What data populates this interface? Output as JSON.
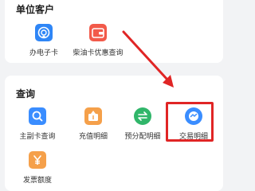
{
  "sections": {
    "top": {
      "title": "单位客户",
      "items": [
        {
          "label": "办电子卡",
          "icon": "e-card-icon",
          "color": "#2f86f6"
        },
        {
          "label": "柴油卡优惠查询",
          "icon": "wallet-icon",
          "color": "#f25a4a"
        }
      ]
    },
    "query": {
      "title": "查询",
      "items": [
        {
          "label": "主副卡查询",
          "icon": "search-icon",
          "color": "#3a8dff"
        },
        {
          "label": "充值明细",
          "icon": "recharge-icon",
          "color": "#f5a04a"
        },
        {
          "label": "预分配明细",
          "icon": "transfer-icon",
          "color": "#30b66a"
        },
        {
          "label": "交易明细",
          "icon": "transaction-icon",
          "color": "#3a8dff"
        },
        {
          "label": "发票额度",
          "icon": "invoice-icon",
          "color": "#f5a04a"
        }
      ]
    }
  },
  "annotation": {
    "highlight_color": "#e02525"
  }
}
